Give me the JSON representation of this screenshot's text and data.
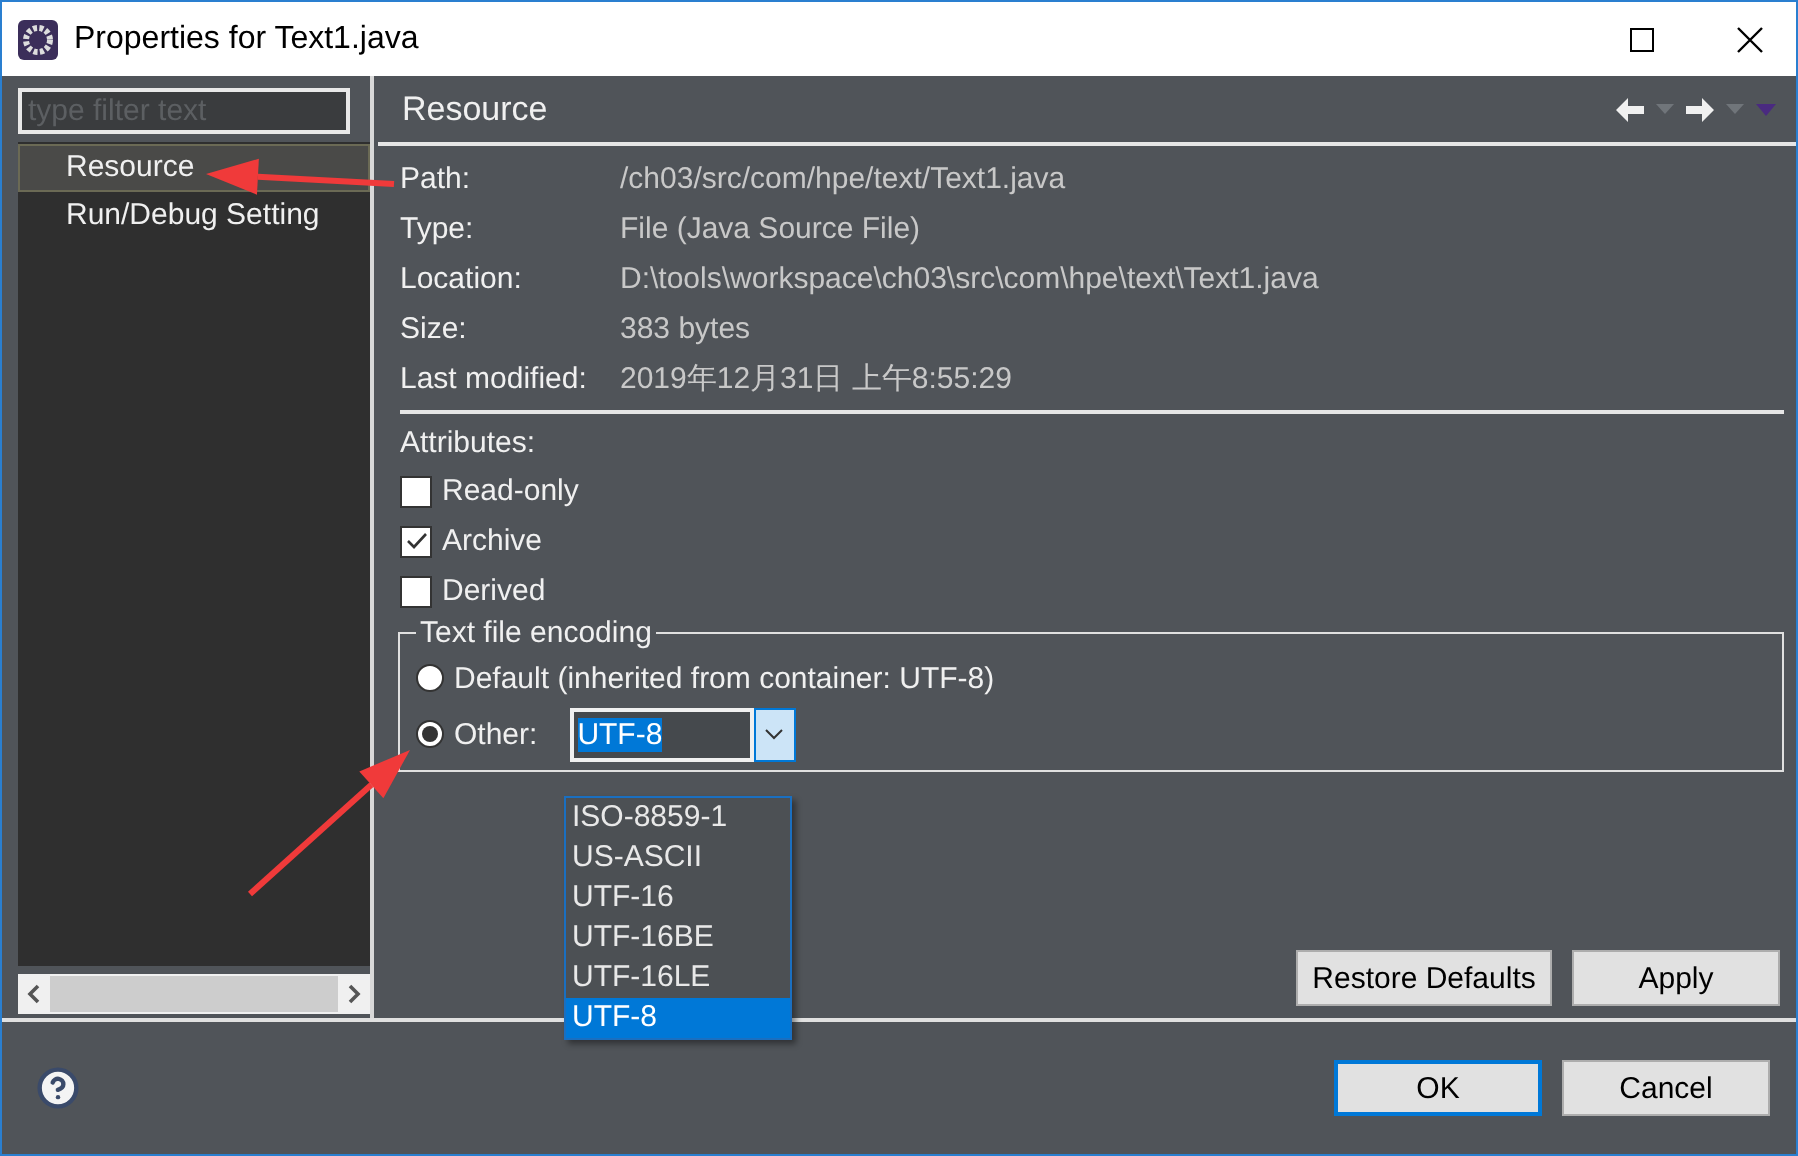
{
  "window": {
    "title": "Properties for Text1.java"
  },
  "sidebar": {
    "filter": {
      "placeholder": "type filter text"
    },
    "items": [
      {
        "label": "Resource",
        "selected": true
      },
      {
        "label": "Run/Debug Setting",
        "selected": false
      }
    ]
  },
  "page": {
    "title": "Resource"
  },
  "info": [
    {
      "label": "Path:",
      "value": "/ch03/src/com/hpe/text/Text1.java"
    },
    {
      "label": "Type:",
      "value": "File  (Java Source File)"
    },
    {
      "label": "Location:",
      "value": "D:\\tools\\workspace\\ch03\\src\\com\\hpe\\text\\Text1.java"
    },
    {
      "label": "Size:",
      "value": "383  bytes"
    },
    {
      "label": "Last modified:",
      "value": "2019年12月31日 上午8:55:29"
    }
  ],
  "attributes": {
    "title": "Attributes:",
    "items": [
      {
        "label": "Read-only",
        "checked": false
      },
      {
        "label": "Archive",
        "checked": true
      },
      {
        "label": "Derived",
        "checked": false
      }
    ]
  },
  "encoding": {
    "title": "Text file encoding",
    "options": [
      {
        "label": "Default (inherited from container: UTF-8)",
        "selected": false
      },
      {
        "label": "Other:",
        "selected": true
      }
    ],
    "combo": {
      "value": "UTF-8",
      "options": [
        {
          "label": "ISO-8859-1",
          "selected": false
        },
        {
          "label": "US-ASCII",
          "selected": false
        },
        {
          "label": "UTF-16",
          "selected": false
        },
        {
          "label": "UTF-16BE",
          "selected": false
        },
        {
          "label": "UTF-16LE",
          "selected": false
        },
        {
          "label": "UTF-8",
          "selected": true
        }
      ]
    }
  },
  "page_buttons": [
    "Restore Defaults",
    "Apply"
  ],
  "dialog_buttons": [
    {
      "label": "OK",
      "default": true
    },
    {
      "label": "Cancel",
      "default": false
    }
  ]
}
